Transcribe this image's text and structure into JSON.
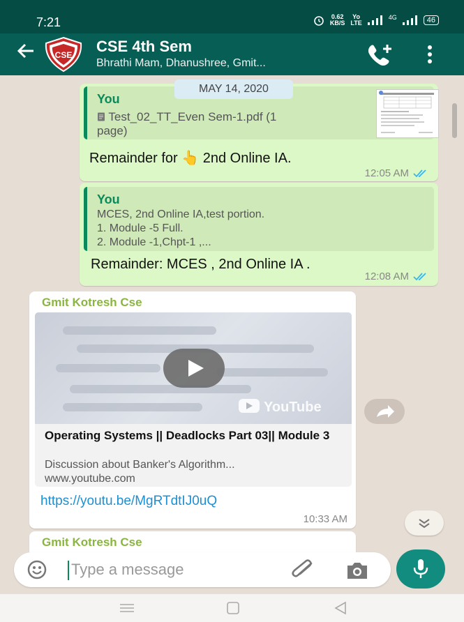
{
  "statusbar": {
    "time": "7:21",
    "speed_value": "0.62",
    "speed_unit": "KB/S",
    "volte_top": "Yo",
    "volte_bottom": "LTE",
    "network": "4G",
    "battery": "46"
  },
  "header": {
    "title": "CSE 4th Sem",
    "subtitle": "Bhrathi Mam, Dhanushree, Gmit...",
    "avatar_text": "CSE"
  },
  "chat": {
    "date_chip": "MAY 14, 2020",
    "messages": [
      {
        "quote_author": "You",
        "quote_doc": "Test_02_TT_Even Sem-1.pdf (1",
        "quote_doc_2": "page)",
        "text_before": "Remainder for",
        "emoji": "👆",
        "text_after": "2nd Online IA.",
        "time": "12:05 AM"
      },
      {
        "quote_author": "You",
        "quote_line1": "MCES, 2nd Online IA,test portion.",
        "quote_line2": "1. Module -5 Full.",
        "quote_line3": "2. Module -1,Chpt-1 ,...",
        "text": "Remainder: MCES , 2nd Online IA .",
        "time": "12:08 AM"
      },
      {
        "sender": "Gmit Kotresh Cse",
        "preview_brand": "YouTube",
        "preview_title": "Operating Systems || Deadlocks Part 03|| Module 3",
        "preview_desc": "Discussion about Banker's Algorithm...",
        "preview_url": "www.youtube.com",
        "link": "https://youtu.be/MgRTdtIJ0uQ",
        "time": "10:33 AM"
      },
      {
        "sender": "Gmit Kotresh Cse"
      }
    ]
  },
  "input": {
    "placeholder": "Type a message"
  },
  "colors": {
    "header": "#075e54",
    "status": "#054d44",
    "outgoing": "#dcf8c6",
    "accent": "#128c7e",
    "sender": "#8ab63f",
    "link": "#1d8fd3"
  },
  "icons": [
    "back-arrow-icon",
    "add-call-icon",
    "more-vert-icon",
    "pdf-icon",
    "double-tick-icon",
    "play-icon",
    "forward-icon",
    "chevron-double-down-icon",
    "emoji-icon",
    "attach-icon",
    "camera-icon",
    "mic-icon",
    "nav-menu-icon",
    "nav-home-icon",
    "nav-back-icon"
  ]
}
